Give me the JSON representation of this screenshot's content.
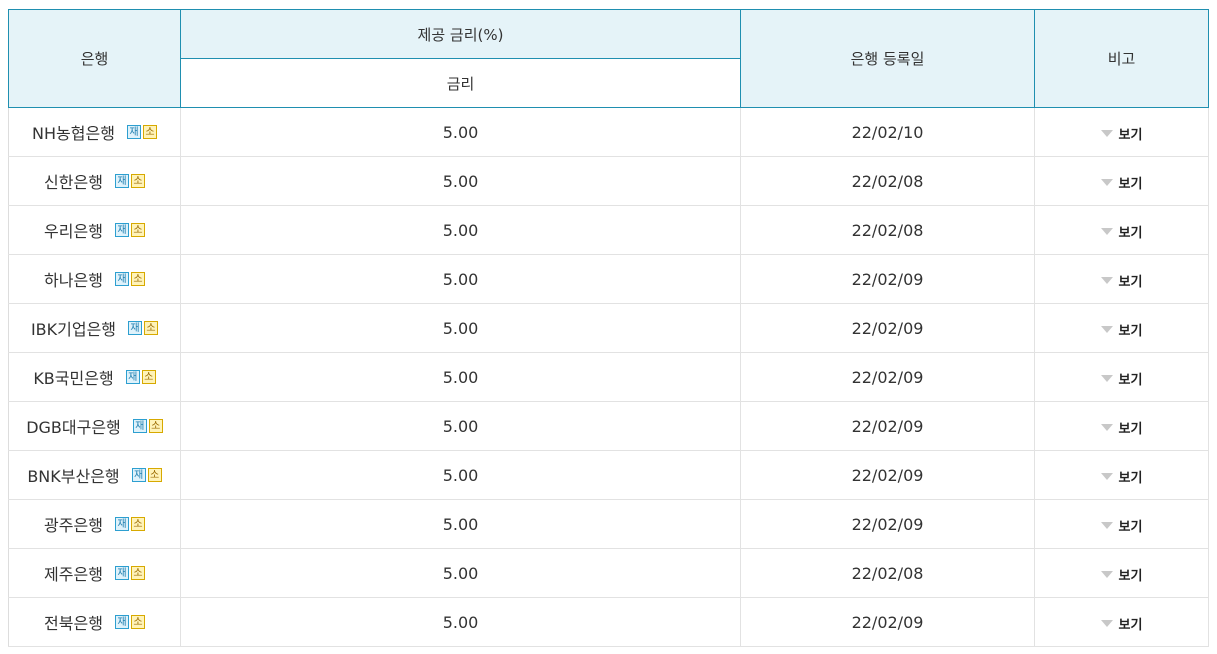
{
  "header": {
    "bank": "은행",
    "rate_group": "제공 금리(%)",
    "rate": "금리",
    "reg_date": "은행 등록일",
    "note": "비고"
  },
  "badges": {
    "re": "재",
    "so": "소"
  },
  "colors": {
    "header_bg": "#e5f3f8",
    "header_border": "#1f8fb0",
    "row_border": "#e2e2e2"
  },
  "rows": [
    {
      "bank": "NH농협은행",
      "rate": "5.00",
      "date": "22/02/10",
      "note": "보기"
    },
    {
      "bank": "신한은행",
      "rate": "5.00",
      "date": "22/02/08",
      "note": "보기"
    },
    {
      "bank": "우리은행",
      "rate": "5.00",
      "date": "22/02/08",
      "note": "보기"
    },
    {
      "bank": "하나은행",
      "rate": "5.00",
      "date": "22/02/09",
      "note": "보기"
    },
    {
      "bank": "IBK기업은행",
      "rate": "5.00",
      "date": "22/02/09",
      "note": "보기"
    },
    {
      "bank": "KB국민은행",
      "rate": "5.00",
      "date": "22/02/09",
      "note": "보기"
    },
    {
      "bank": "DGB대구은행",
      "rate": "5.00",
      "date": "22/02/09",
      "note": "보기"
    },
    {
      "bank": "BNK부산은행",
      "rate": "5.00",
      "date": "22/02/09",
      "note": "보기"
    },
    {
      "bank": "광주은행",
      "rate": "5.00",
      "date": "22/02/09",
      "note": "보기"
    },
    {
      "bank": "제주은행",
      "rate": "5.00",
      "date": "22/02/08",
      "note": "보기"
    },
    {
      "bank": "전북은행",
      "rate": "5.00",
      "date": "22/02/09",
      "note": "보기"
    }
  ]
}
